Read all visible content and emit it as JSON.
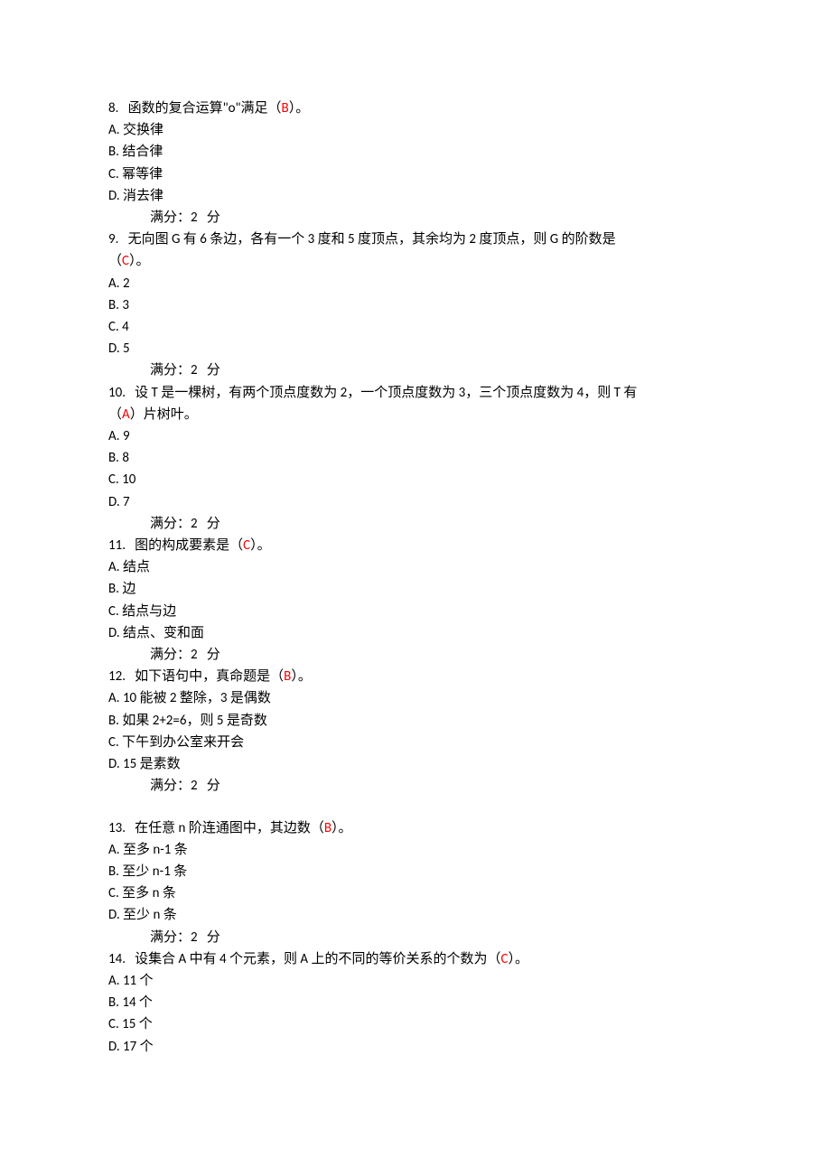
{
  "q8": {
    "stem_pre": "8.   函数的复合运算\"ο\"满足（",
    "answer": "B",
    "stem_post": "）。",
    "A": "A. 交换律",
    "B": "B. 结合律",
    "C": "C. 幂等律",
    "D": "D. 消去律",
    "score": "满分：2   分"
  },
  "q9": {
    "line1": "9.   无向图 G 有 6 条边，各有一个 3 度和 5 度顶点，其余均为 2 度顶点，则 G 的阶数是",
    "line2_pre": "（",
    "answer": "C",
    "line2_post": "）。",
    "A": "A. 2",
    "B": "B. 3",
    "C": "C. 4",
    "D": "D. 5",
    "score": "满分：2   分"
  },
  "q10": {
    "line1": "10.   设 T 是一棵树，有两个顶点度数为 2，一个顶点度数为 3，三个顶点度数为 4，则 T 有",
    "line2_pre": "（",
    "answer": "A",
    "line2_post": "）片树叶。",
    "A": "A. 9",
    "B": "B. 8",
    "C": "C. 10",
    "D": "D. 7",
    "score": "满分：2   分"
  },
  "q11": {
    "stem_pre": "11.   图的构成要素是（",
    "answer": "C",
    "stem_post": "）。",
    "A": "A. 结点",
    "B": "B. 边",
    "C": "C. 结点与边",
    "D": "D. 结点、变和面",
    "score": "满分：2   分"
  },
  "q12": {
    "stem_pre": "12.   如下语句中，真命题是（",
    "answer": "B",
    "stem_post": "）。",
    "A": "A. 10 能被 2 整除，3 是偶数",
    "B": "B. 如果 2+2=6，则 5 是奇数",
    "C": "C. 下午到办公室来开会",
    "D": "D. 15 是素数",
    "score": "满分：2   分"
  },
  "q13": {
    "stem_pre": "13.   在任意 n 阶连通图中，其边数（",
    "answer": "B",
    "stem_post": "）。",
    "A": "A. 至多 n-1 条",
    "B": "B. 至少 n-1 条",
    "C": "C. 至多 n 条",
    "D": "D. 至少 n 条",
    "score": "满分：2   分"
  },
  "q14": {
    "stem_pre": "14.   设集合 A 中有 4 个元素，则 A 上的不同的等价关系的个数为（",
    "answer": "C",
    "stem_post": "）。",
    "A": "A. 11 个",
    "B": "B. 14 个",
    "C": "C. 15 个",
    "D": "D. 17 个"
  }
}
